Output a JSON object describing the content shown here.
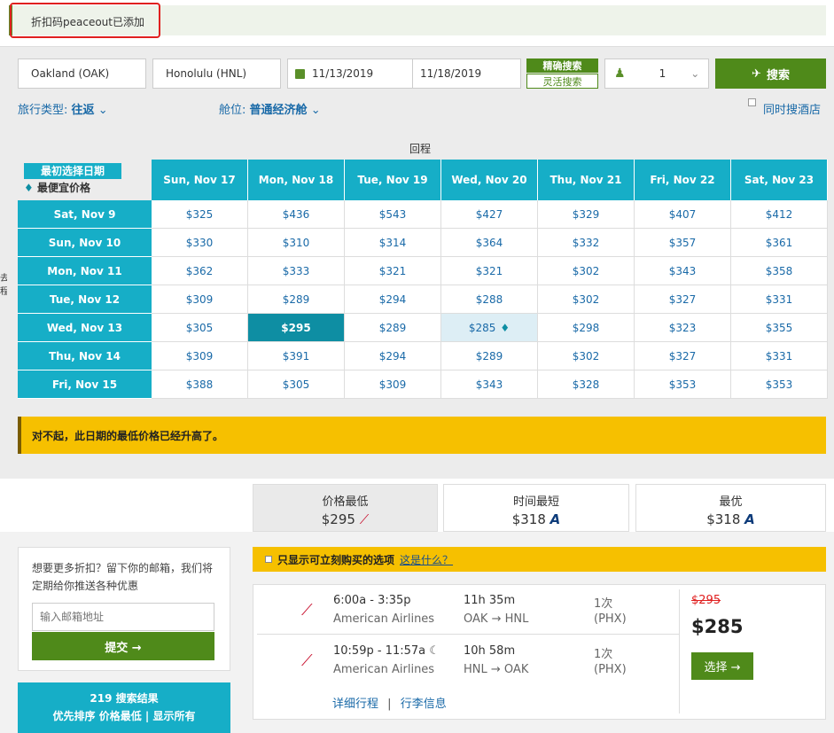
{
  "banner": {
    "text": "折扣码peaceout已添加"
  },
  "search": {
    "origin": "Oakland (OAK)",
    "destination": "Honolulu (HNL)",
    "depart_date": "11/13/2019",
    "return_date": "11/18/2019",
    "mode_exact": "精确搜索",
    "mode_flex": "灵活搜索",
    "passengers": "1",
    "search_button": "搜索",
    "trip_type_label": "旅行类型:",
    "trip_type_value": "往返",
    "cabin_label": "舱位:",
    "cabin_value": "普通经济舱",
    "hotel_checkbox": "同时搜酒店"
  },
  "grid": {
    "return_label": "回程",
    "depart_label": "去程",
    "legend_initial": "最初选择日期",
    "legend_cheapest": "最便宜价格",
    "columns": [
      "Sun, Nov 17",
      "Mon, Nov 18",
      "Tue, Nov 19",
      "Wed, Nov 20",
      "Thu, Nov 21",
      "Fri, Nov 22",
      "Sat, Nov 23"
    ],
    "rows": [
      {
        "label": "Sat, Nov 9",
        "prices": [
          "$325",
          "$436",
          "$543",
          "$427",
          "$329",
          "$407",
          "$412"
        ]
      },
      {
        "label": "Sun, Nov 10",
        "prices": [
          "$330",
          "$310",
          "$314",
          "$364",
          "$332",
          "$357",
          "$361"
        ]
      },
      {
        "label": "Mon, Nov 11",
        "prices": [
          "$362",
          "$333",
          "$321",
          "$321",
          "$302",
          "$343",
          "$358"
        ]
      },
      {
        "label": "Tue, Nov 12",
        "prices": [
          "$309",
          "$289",
          "$294",
          "$288",
          "$302",
          "$327",
          "$331"
        ]
      },
      {
        "label": "Wed, Nov 13",
        "prices": [
          "$305",
          "$295",
          "$289",
          "$285",
          "$298",
          "$323",
          "$355"
        ]
      },
      {
        "label": "Thu, Nov 14",
        "prices": [
          "$309",
          "$391",
          "$294",
          "$289",
          "$302",
          "$327",
          "$331"
        ]
      },
      {
        "label": "Fri, Nov 15",
        "prices": [
          "$388",
          "$305",
          "$309",
          "$343",
          "$328",
          "$353",
          "$353"
        ]
      }
    ]
  },
  "warning": "对不起，此日期的最低价格已经升高了。",
  "sort_tabs": [
    {
      "title": "价格最低",
      "price": "$295"
    },
    {
      "title": "时间最短",
      "price": "$318"
    },
    {
      "title": "最优",
      "price": "$318"
    }
  ],
  "email_box": {
    "text": "想要更多折扣？留下你的邮箱，我们将定期给你推送各种优惠",
    "placeholder": "输入邮箱地址",
    "submit": "提交 →"
  },
  "results_header": {
    "count": "219 搜索结果",
    "sort_line": "优先排序 价格最低 | 显示所有"
  },
  "filter_bar": {
    "text": "只显示可立刻购买的选项",
    "link": "这是什么？"
  },
  "itinerary": {
    "outbound": {
      "time": "6:00a - 3:35p",
      "airline": "American Airlines",
      "duration": "11h 35m",
      "route_from": "OAK",
      "route_to": "HNL",
      "stops": "1次",
      "via": "(PHX)"
    },
    "inbound": {
      "time": "10:59p - 11:57a",
      "airline": "American Airlines",
      "duration": "10h 58m",
      "route_from": "HNL",
      "route_to": "OAK",
      "stops": "1次",
      "via": "(PHX)"
    },
    "old_price": "$295",
    "price": "$285",
    "select_button": "选择 →",
    "details_link": "详细行程",
    "baggage_link": "行李信息"
  },
  "colors": {
    "accent_green": "#4f8a1a",
    "teal": "#16aec7",
    "warning_yellow": "#f6c000",
    "link_blue": "#1a6aa8"
  }
}
